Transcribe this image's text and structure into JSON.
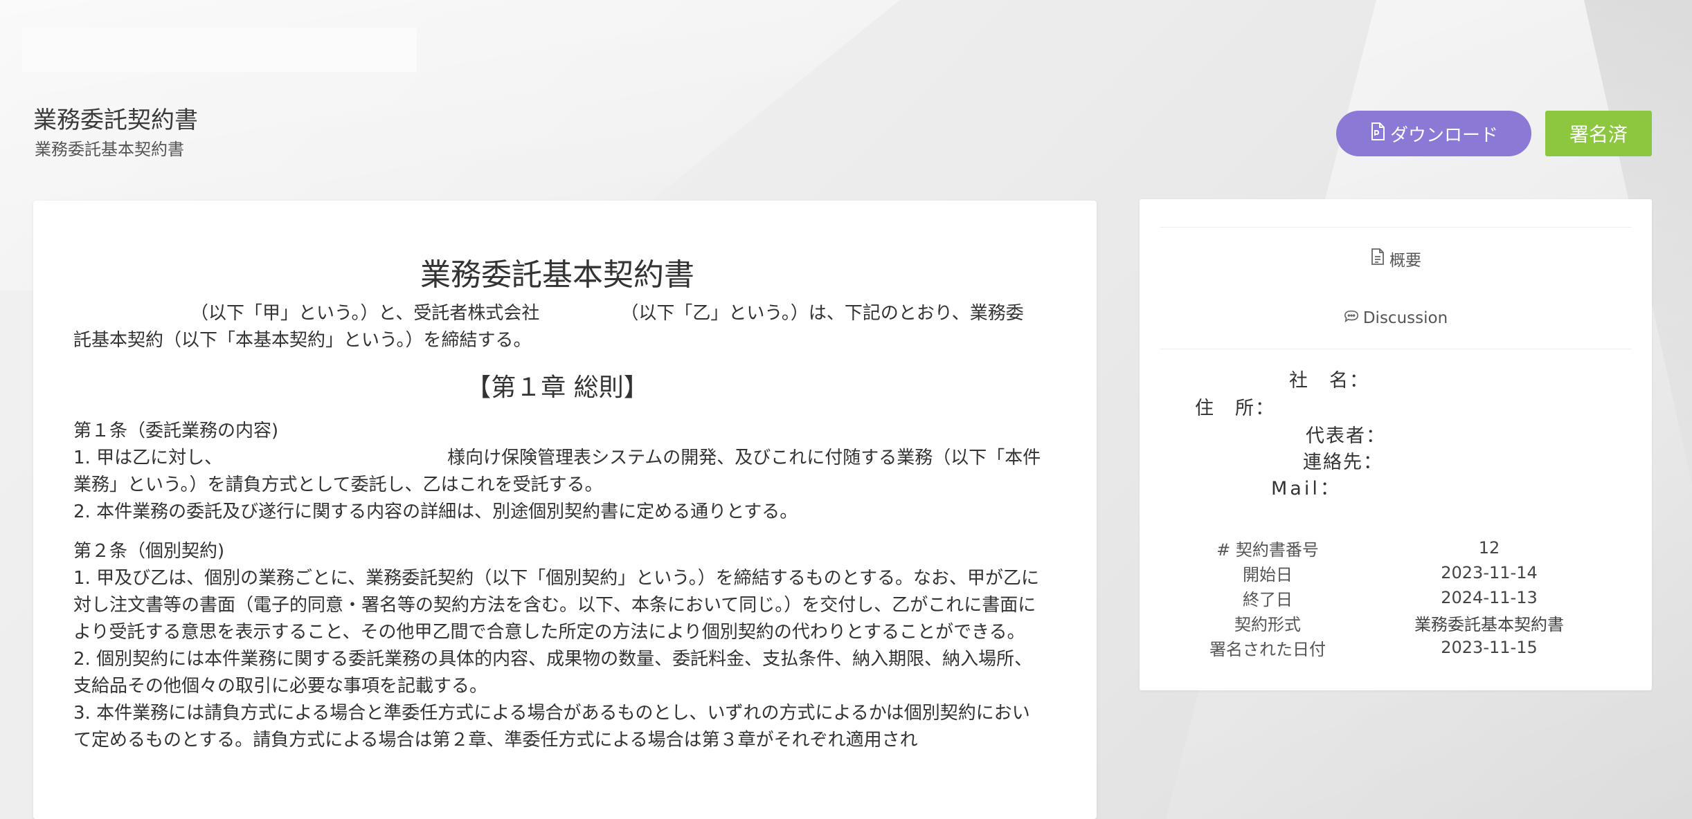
{
  "header": {
    "title": "業務委託契約書",
    "subtitle": "業務委託基本契約書",
    "download_label": "ダウンロード",
    "signed_label": "署名済",
    "download_icon": "pdf-file-icon"
  },
  "document": {
    "title": "業務委託基本契約書",
    "intro": "　　　　　　　（以下「甲」という。）と、受託者株式会社　　　　　（以下「乙」という。）は、下記のとおり、業務委託基本契約（以下「本基本契約」という。）を締結する。",
    "chapter1_title": "【第１章 総則】",
    "articles": [
      {
        "heading": "第１条（委託業務の内容)",
        "items": [
          "1. 甲は乙に対し、　　　　　　　　　　　　　様向け保険管理表システムの開発、及びこれに付随する業務（以下「本件業務」という。）を請負方式として委託し、乙はこれを受託する。",
          "2. 本件業務の委託及び遂行に関する内容の詳細は、別途個別契約書に定める通りとする。"
        ]
      },
      {
        "heading": "第２条（個別契約)",
        "items": [
          "1. 甲及び乙は、個別の業務ごとに、業務委託契約（以下「個別契約」という。）を締結するものとする。なお、甲が乙に対し注文書等の書面（電子的同意・署名等の契約方法を含む。以下、本条において同じ。）を交付し、乙がこれに書面により受託する意思を表示すること、その他甲乙間で合意した所定の方法により個別契約の代わりとすることができる。",
          "2. 個別契約には本件業務に関する委託業務の具体的内容、成果物の数量、委託料金、支払条件、納入期限、納入場所、支給品その他個々の取引に必要な事項を記載する。",
          "3. 本件業務には請負方式による場合と準委任方式による場合があるものとし、いずれの方式によるかは個別契約において定めるものとする。請負方式による場合は第２章、準委任方式による場合は第３章がそれぞれ適用され"
        ]
      }
    ]
  },
  "sidebar": {
    "tab_overview": "概要",
    "tab_overview_icon": "document-icon",
    "tab_discussion": "Discussion",
    "tab_discussion_icon": "chat-bubble-icon",
    "company": {
      "name_label": "社　名：",
      "address_label": "住　所：",
      "representative_label": "代表者：",
      "contact_label": "連絡先：",
      "mail_label": "Mail："
    },
    "meta": [
      {
        "label": "# 契約書番号",
        "value": "12"
      },
      {
        "label": "開始日",
        "value": "2023-11-14"
      },
      {
        "label": "終了日",
        "value": "2024-11-13"
      },
      {
        "label": "契約形式",
        "value": "業務委託基本契約書"
      },
      {
        "label": "署名された日付",
        "value": "2023-11-15"
      }
    ]
  },
  "colors": {
    "download_button": "#8c79d6",
    "signed_badge": "#8dc63f",
    "background": "#ececec"
  }
}
